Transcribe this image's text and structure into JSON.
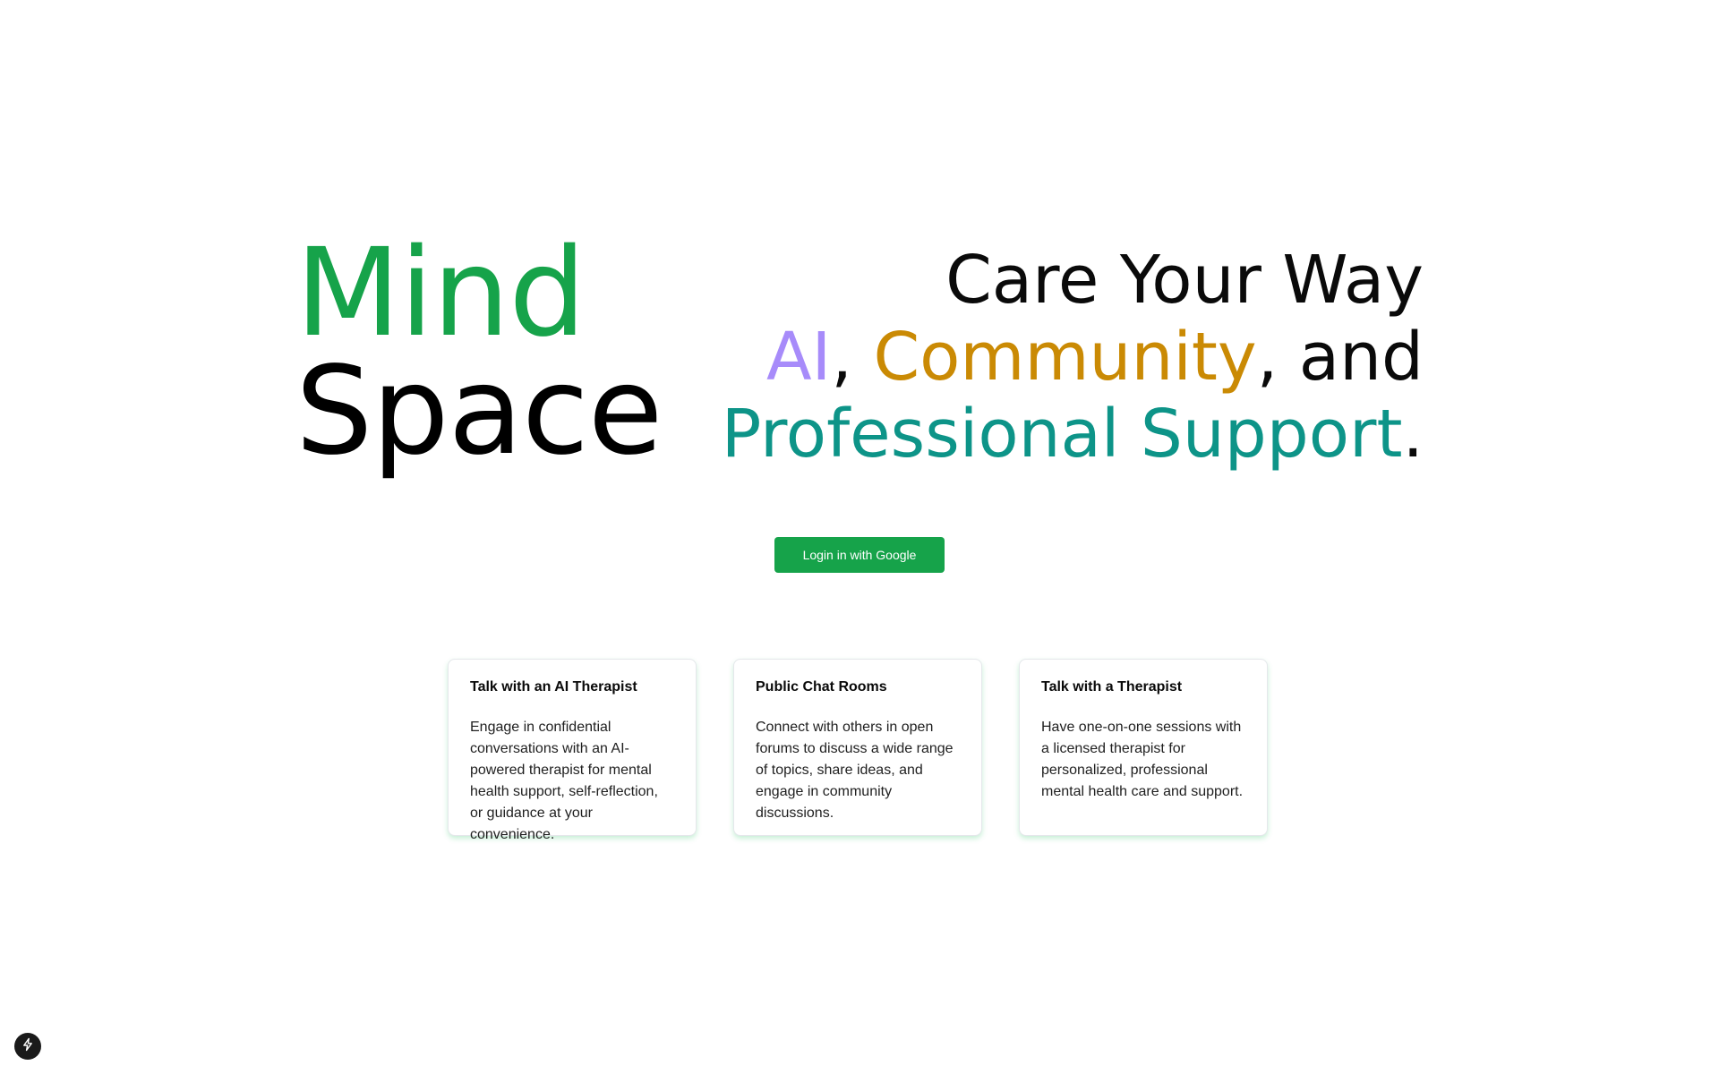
{
  "brand": {
    "word1": "Mind",
    "word2": "Space"
  },
  "tagline": {
    "line1": "Care Your Way",
    "line2": {
      "ai": "AI",
      "sep1": ", ",
      "community": "Community",
      "sep2": ", and"
    },
    "line3": {
      "professional": "Professional Support",
      "period": "."
    }
  },
  "auth": {
    "login_label": "Login in with Google"
  },
  "features": [
    {
      "title": "Talk with an AI Therapist",
      "description": "Engage in confidential conversations with an AI-powered therapist for mental health support, self-reflection, or guidance at your convenience."
    },
    {
      "title": "Public Chat Rooms",
      "description": "Connect with others in open forums to discuss a wide range of topics, share ideas, and engage in community discussions."
    },
    {
      "title": "Talk with a Therapist",
      "description": "Have one-on-one sessions with a licensed therapist for personalized, professional mental health care and support."
    }
  ],
  "colors": {
    "brand_green": "#16a34a",
    "ai_purple": "#a78bfa",
    "community_gold": "#ca8a04",
    "professional_teal": "#0d9488"
  },
  "icons": {
    "bottom_badge": "lightning-bolt-icon"
  }
}
